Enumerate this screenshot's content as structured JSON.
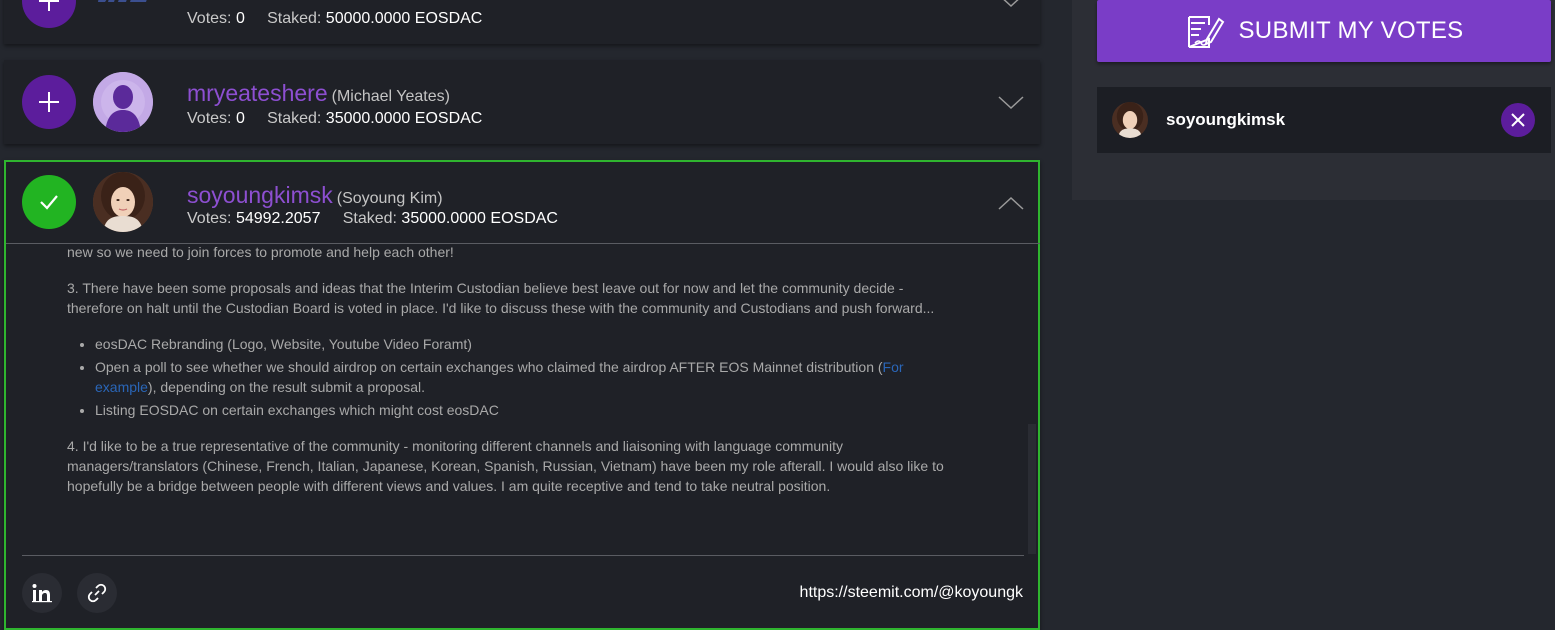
{
  "candidates": [
    {
      "name": "",
      "real_name": "",
      "votes_label": "Votes:",
      "votes": "0",
      "staked_label": "Staked:",
      "staked": "50000.0000 EOSDAC"
    },
    {
      "name": "mryeateshere",
      "real_name": "(Michael Yeates)",
      "votes_label": "Votes:",
      "votes": "0",
      "staked_label": "Staked:",
      "staked": "35000.0000 EOSDAC"
    },
    {
      "name": "soyoungkimsk",
      "real_name": "(Soyoung Kim)",
      "votes_label": "Votes:",
      "votes": "54992.2057",
      "staked_label": "Staked:",
      "staked": "35000.0000 EOSDAC",
      "description": {
        "p0": "new so we need to join forces to promote and help each other!",
        "p1": "3. There have been some proposals and ideas that the Interim Custodian believe best leave out for now and let the community decide - therefore on halt until the Custodian Board is voted in place. I'd like to discuss these with the community and Custodians and push forward...",
        "b0": "eosDAC Rebranding (Logo, Website, Youtube Video Foramt)",
        "b1_pre": "Open a poll to see whether we should airdrop on certain exchanges who claimed the airdrop AFTER EOS Mainnet distribution (",
        "b1_link": "For example",
        "b1_post": "), depending on the result submit a proposal.",
        "b2": "Listing EOSDAC on certain exchanges which might cost eosDAC",
        "p2": "4. I'd like to be a true representative of the community - monitoring different channels and liaisoning with language community managers/translators (Chinese, French, Italian, Japanese, Korean, Spanish, Russian, Vietnam) have been my role afterall. I would also like to hopefully be a bridge between people with different views and values. I am quite receptive and tend to take neutral position."
      },
      "profile_url": "https://steemit.com/@koyoungk"
    }
  ],
  "sidebar": {
    "submit_label": "SUBMIT MY VOTES",
    "selected": [
      {
        "name": "soyoungkimsk"
      }
    ]
  },
  "colors": {
    "accent": "#7a3dc7",
    "name": "#8d4fd1",
    "voted": "#22b422",
    "background": "#24272e"
  }
}
